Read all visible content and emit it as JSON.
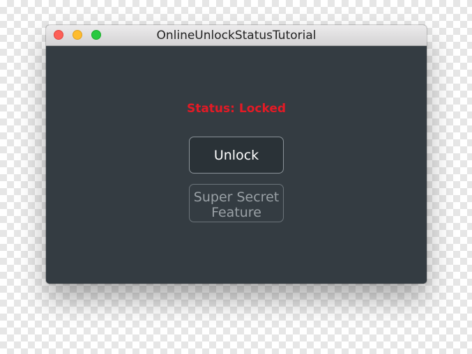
{
  "window": {
    "title": "OnlineUnlockStatusTutorial"
  },
  "content": {
    "status_text": "Status: Locked",
    "unlock_label": "Unlock",
    "secret_label_line1": "Super Secret",
    "secret_label_line2": "Feature"
  },
  "colors": {
    "background": "#343c42",
    "status": "#e41a25",
    "traffic_close": "#fd5f57",
    "traffic_minimize": "#febc2e",
    "traffic_zoom": "#29c940"
  }
}
